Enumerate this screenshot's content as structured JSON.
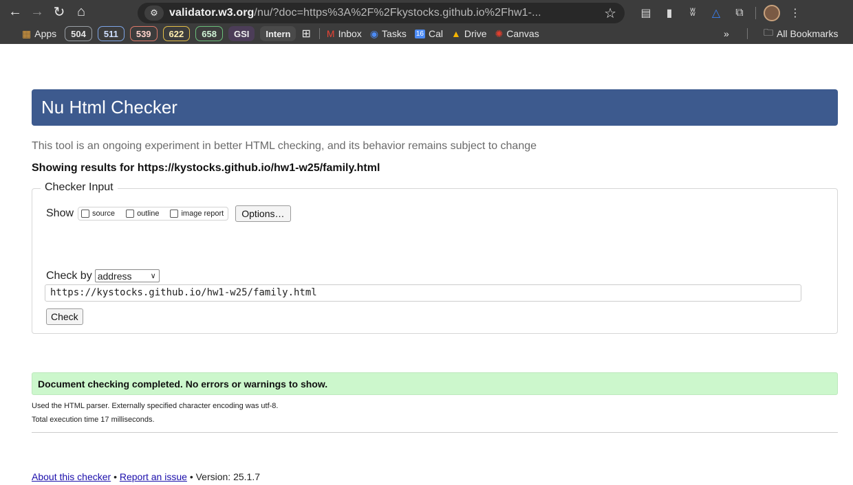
{
  "browser": {
    "url_host": "validator.w3.org",
    "url_rest": "/nu/?doc=https%3A%2F%2Fkystocks.github.io%2Fhw1-...",
    "bookmarks": {
      "apps": "Apps",
      "pills": [
        "504",
        "511",
        "539",
        "622",
        "658"
      ],
      "gsi": "GSI",
      "intern": "Intern",
      "inbox": "Inbox",
      "tasks": "Tasks",
      "cal": "Cal",
      "cal_date": "16",
      "drive": "Drive",
      "canvas": "Canvas",
      "more": "»",
      "all_bookmarks": "All Bookmarks"
    }
  },
  "page": {
    "title": "Nu Html Checker",
    "intro": "This tool is an ongoing experiment in better HTML checking, and its behavior remains subject to change",
    "showing": "Showing results for https://kystocks.github.io/hw1-w25/family.html",
    "checker_input": {
      "legend": "Checker Input",
      "show_label": "Show",
      "options": [
        "source",
        "outline",
        "image report"
      ],
      "options_button": "Options…",
      "check_by_label": "Check by",
      "check_by_value": "address",
      "url_value": "https://kystocks.github.io/hw1-w25/family.html",
      "check_button": "Check"
    },
    "result": "Document checking completed. No errors or warnings to show.",
    "parser_note": "Used the HTML parser. Externally specified character encoding was utf-8.",
    "exec_time": "Total execution time 17 milliseconds.",
    "footer": {
      "about": "About this checker",
      "sep": "•",
      "report": "Report an issue",
      "version": "Version: 25.1.7"
    }
  }
}
